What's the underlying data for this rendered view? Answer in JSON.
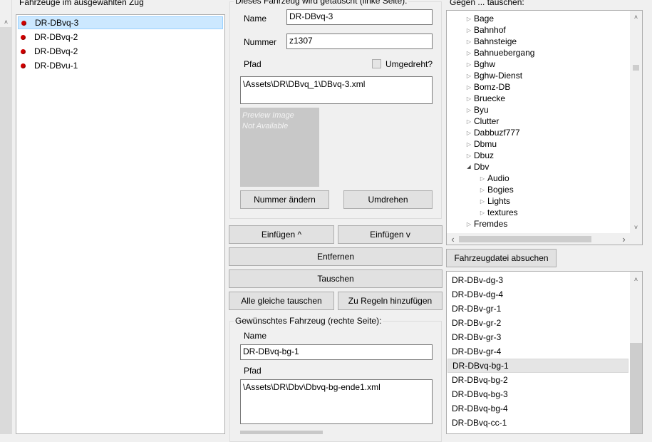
{
  "left": {
    "title": "Fahrzeuge im ausgewählten Zug",
    "items": [
      "DR-DBvq-3",
      "DR-DBvq-2",
      "DR-DBvq-2",
      "DR-DBvu-1"
    ]
  },
  "replaced": {
    "title": "Dieses Fahrzeug wird getauscht (linke Seite):",
    "name_label": "Name",
    "name_value": "DR-DBvq-3",
    "number_label": "Nummer",
    "number_value": "z1307",
    "path_label": "Pfad",
    "reversed_label": "Umgedreht?",
    "path_value": "\\Assets\\DR\\DBvq_1\\DBvq-3.xml",
    "preview_line1": "Preview Image",
    "preview_line2": "Not Available",
    "change_number_button": "Nummer ändern",
    "reverse_button": "Umdrehen"
  },
  "actions": {
    "insert_up": "Einfügen ^",
    "insert_down": "Einfügen v",
    "remove": "Entfernen",
    "swap": "Tauschen",
    "swap_all": "Alle gleiche tauschen",
    "add_rules": "Zu Regeln hinzufügen"
  },
  "desired": {
    "title": "Gewünschtes Fahrzeug (rechte Seite):",
    "name_label": "Name",
    "name_value": "DR-DBvq-bg-1",
    "path_label": "Pfad",
    "path_value": "\\Assets\\DR\\Dbv\\Dbvq-bg-ende1.xml"
  },
  "right": {
    "title": "Gegen ... tauschen:",
    "tree": [
      {
        "label": "Bage",
        "level": 0,
        "state": "collapsed"
      },
      {
        "label": "Bahnhof",
        "level": 0,
        "state": "collapsed"
      },
      {
        "label": "Bahnsteige",
        "level": 0,
        "state": "collapsed"
      },
      {
        "label": "Bahnuebergang",
        "level": 0,
        "state": "collapsed"
      },
      {
        "label": "Bghw",
        "level": 0,
        "state": "collapsed"
      },
      {
        "label": "Bghw-Dienst",
        "level": 0,
        "state": "collapsed"
      },
      {
        "label": "Bomz-DB",
        "level": 0,
        "state": "collapsed"
      },
      {
        "label": "Bruecke",
        "level": 0,
        "state": "collapsed"
      },
      {
        "label": "Byu",
        "level": 0,
        "state": "collapsed"
      },
      {
        "label": "Clutter",
        "level": 0,
        "state": "collapsed"
      },
      {
        "label": "Dabbuzf777",
        "level": 0,
        "state": "collapsed"
      },
      {
        "label": "Dbmu",
        "level": 0,
        "state": "collapsed"
      },
      {
        "label": "Dbuz",
        "level": 0,
        "state": "collapsed"
      },
      {
        "label": "Dbv",
        "level": 0,
        "state": "expanded"
      },
      {
        "label": "Audio",
        "level": 1,
        "state": "collapsed"
      },
      {
        "label": "Bogies",
        "level": 1,
        "state": "collapsed"
      },
      {
        "label": "Lights",
        "level": 1,
        "state": "collapsed"
      },
      {
        "label": "textures",
        "level": 1,
        "state": "collapsed"
      },
      {
        "label": "Fremdes",
        "level": 0,
        "state": "collapsed"
      }
    ],
    "search_button": "Fahrzeugdatei absuchen",
    "files": [
      "DR-DBv-dg-3",
      "DR-DBv-dg-4",
      "DR-DBv-gr-1",
      "DR-DBv-gr-2",
      "DR-DBv-gr-3",
      "DR-DBv-gr-4",
      "DR-DBvq-bg-1",
      "DR-DBvq-bg-2",
      "DR-DBvq-bg-3",
      "DR-DBvq-bg-4",
      "DR-DBvq-cc-1"
    ],
    "selected_file": 6
  },
  "icons": {
    "tree_collapsed": "▷",
    "tree_expanded": "◢",
    "scroll_up": "˄",
    "scroll_down": "˅",
    "scroll_left": "‹",
    "scroll_right": "›"
  },
  "colors": {
    "selection_bg": "#cce8ff",
    "dot": "#d00000"
  }
}
